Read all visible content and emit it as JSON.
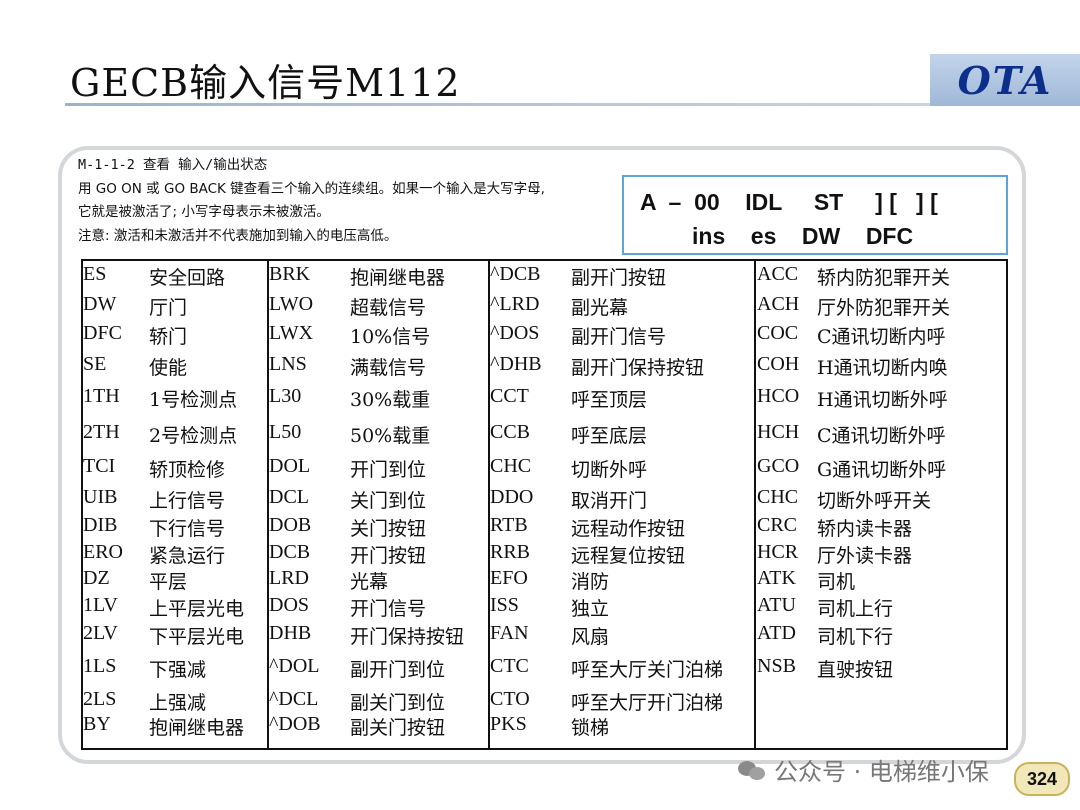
{
  "slide": {
    "title": "GECB输入信号M112",
    "logo": "OTA",
    "page_number": "324"
  },
  "intro": {
    "line1": "M-1-1-2  查看 输入/输出状态",
    "line2": "用 GO ON 或 GO BACK 键查看三个输入的连续组。如果一个输入是大写字母,",
    "line3": "它就是被激活了; 小写字母表示未被激活。",
    "line4": "注意: 激活和未激活并不代表施加到输入的电压高低。"
  },
  "lcd": {
    "row1": "A  –  00    IDL     ST     ] [   ] [",
    "row2": "ins    es    DW    DFC"
  },
  "table": {
    "columns": [
      [
        [
          "ES",
          "安全回路"
        ],
        [
          "DW",
          "厅门"
        ],
        [
          "DFC",
          "轿门"
        ],
        [
          "SE",
          "使能"
        ],
        [
          "1TH",
          "1号检测点"
        ],
        [
          "2TH",
          "2号检测点"
        ],
        [
          "TCI",
          "轿顶检修"
        ],
        [
          "UIB",
          "上行信号"
        ],
        [
          "DIB",
          "下行信号"
        ],
        [
          "ERO",
          "紧急运行"
        ],
        [
          "DZ",
          "平层"
        ],
        [
          "1LV",
          "上平层光电"
        ],
        [
          "2LV",
          "下平层光电"
        ],
        [
          "1LS",
          "下强减"
        ],
        [
          "2LS",
          "上强减"
        ],
        [
          "BY",
          "抱闸继电器"
        ]
      ],
      [
        [
          "BRK",
          "抱闸继电器"
        ],
        [
          "LWO",
          "超载信号"
        ],
        [
          "LWX",
          "10%信号"
        ],
        [
          "LNS",
          "满载信号"
        ],
        [
          "L30",
          "30%载重"
        ],
        [
          "L50",
          "50%载重"
        ],
        [
          "DOL",
          "开门到位"
        ],
        [
          "DCL",
          "关门到位"
        ],
        [
          "DOB",
          "关门按钮"
        ],
        [
          "DCB",
          "开门按钮"
        ],
        [
          "LRD",
          "光幕"
        ],
        [
          "DOS",
          "开门信号"
        ],
        [
          "DHB",
          "开门保持按钮"
        ],
        [
          "^DOL",
          "副开门到位"
        ],
        [
          "^DCL",
          "副关门到位"
        ],
        [
          "^DOB",
          "副关门按钮"
        ]
      ],
      [
        [
          "^DCB",
          "副开门按钮"
        ],
        [
          "^LRD",
          "副光幕"
        ],
        [
          "^DOS",
          "副开门信号"
        ],
        [
          "^DHB",
          "副开门保持按钮"
        ],
        [
          "CCT",
          "呼至顶层"
        ],
        [
          "CCB",
          "呼至底层"
        ],
        [
          "CHC",
          "切断外呼"
        ],
        [
          "DDO",
          "取消开门"
        ],
        [
          "RTB",
          "远程动作按钮"
        ],
        [
          "RRB",
          "远程复位按钮"
        ],
        [
          "EFO",
          "消防"
        ],
        [
          "ISS",
          "独立"
        ],
        [
          "FAN",
          "风扇"
        ],
        [
          "CTC",
          "呼至大厅关门泊梯"
        ],
        [
          "CTO",
          "呼至大厅开门泊梯"
        ],
        [
          "PKS",
          "锁梯"
        ]
      ],
      [
        [
          "ACC",
          "轿内防犯罪开关"
        ],
        [
          "ACH",
          "厅外防犯罪开关"
        ],
        [
          "COC",
          "C通讯切断内呼"
        ],
        [
          "COH",
          "H通讯切断内唤"
        ],
        [
          "HCO",
          "H通讯切断外呼"
        ],
        [
          "HCH",
          "C通讯切断外呼"
        ],
        [
          "GCO",
          "G通讯切断外呼"
        ],
        [
          "CHC",
          "切断外呼开关"
        ],
        [
          "CRC",
          "轿内读卡器"
        ],
        [
          "HCR",
          "厅外读卡器"
        ],
        [
          "ATK",
          "司机"
        ],
        [
          "ATU",
          "司机上行"
        ],
        [
          "ATD",
          "司机下行"
        ],
        [
          "NSB",
          "直驶按钮"
        ]
      ]
    ]
  },
  "footer": {
    "watermark": "公众号 · 电梯维小保"
  }
}
